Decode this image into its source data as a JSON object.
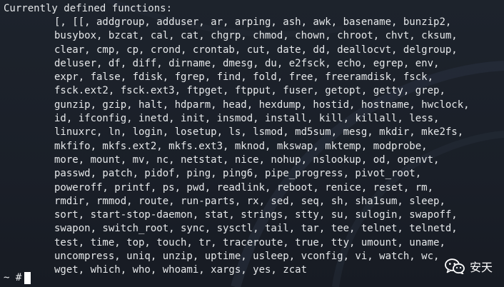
{
  "terminal": {
    "heading": "Currently defined functions:",
    "function_lines": [
      "[, [[, addgroup, adduser, ar, arping, ash, awk, basename, bunzip2,",
      "busybox, bzcat, cal, cat, chgrp, chmod, chown, chroot, chvt, cksum,",
      "clear, cmp, cp, crond, crontab, cut, date, dd, deallocvt, delgroup,",
      "deluser, df, diff, dirname, dmesg, du, e2fsck, echo, egrep, env,",
      "expr, false, fdisk, fgrep, find, fold, free, freeramdisk, fsck,",
      "fsck.ext2, fsck.ext3, ftpget, ftpput, fuser, getopt, getty, grep,",
      "gunzip, gzip, halt, hdparm, head, hexdump, hostid, hostname, hwclock,",
      "id, ifconfig, inetd, init, insmod, install, kill, killall, less,",
      "linuxrc, ln, login, losetup, ls, lsmod, md5sum, mesg, mkdir, mke2fs,",
      "mkfifo, mkfs.ext2, mkfs.ext3, mknod, mkswap, mktemp, modprobe,",
      "more, mount, mv, nc, netstat, nice, nohup, nslookup, od, openvt,",
      "passwd, patch, pidof, ping, ping6, pipe_progress, pivot_root,",
      "poweroff, printf, ps, pwd, readlink, reboot, renice, reset, rm,",
      "rmdir, rmmod, route, run-parts, rx, sed, seq, sh, sha1sum, sleep,",
      "sort, start-stop-daemon, stat, strings, stty, su, sulogin, swapoff,",
      "swapon, switch_root, sync, sysctl, tail, tar, tee, telnet, telnetd,",
      "test, time, top, touch, tr, traceroute, true, tty, umount, uname,",
      "uncompress, uniq, unzip, uptime, usleep, vconfig, vi, watch, wc,",
      "wget, which, who, whoami, xargs, yes, zcat"
    ],
    "prompt": "~ #"
  },
  "watermark": {
    "text": "安天",
    "icon": "wechat-icon"
  }
}
